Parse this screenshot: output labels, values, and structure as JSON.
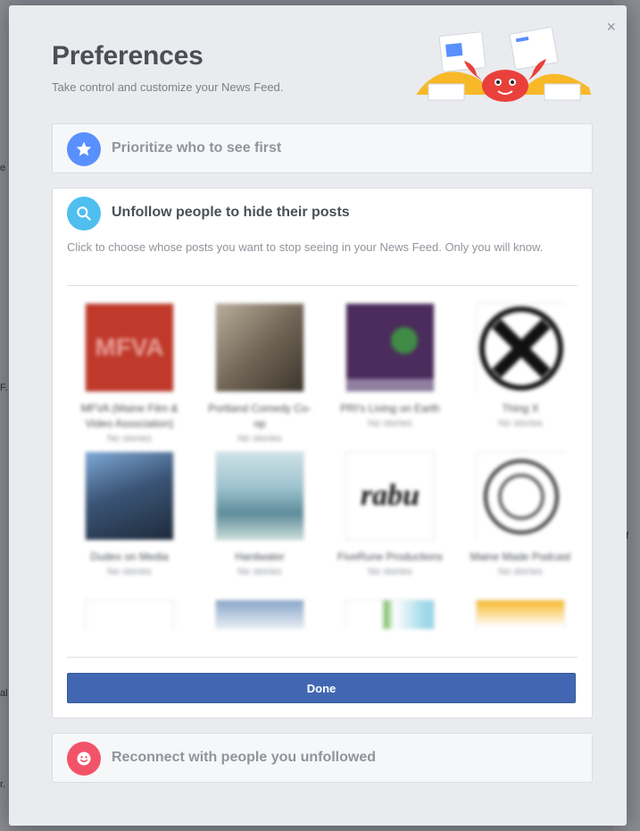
{
  "modal": {
    "title": "Preferences",
    "subtitle": "Take control and customize your News Feed.",
    "close_glyph": "×"
  },
  "sections": {
    "prioritize": {
      "title": "Prioritize who to see first",
      "icon": "star-icon",
      "color": "#5890ff"
    },
    "unfollow": {
      "title": "Unfollow people to hide their posts",
      "icon": "search-icon",
      "color": "#4fbfef",
      "description": "Click to choose whose posts you want to stop seeing in your News Feed. Only you will know.",
      "done_label": "Done"
    },
    "reconnect": {
      "title": "Reconnect with people you unfollowed",
      "icon": "smile-icon",
      "color": "#f35369"
    }
  },
  "pages": [
    {
      "name": "MFVA (Maine Film & Video Association)",
      "meta": "No stories",
      "thumb": "mfva"
    },
    {
      "name": "Portland Comedy Co-op",
      "meta": "No stories",
      "thumb": "sepia"
    },
    {
      "name": "PRI's Living on Earth",
      "meta": "No stories",
      "thumb": "purple"
    },
    {
      "name": "Thing X",
      "meta": "No stories",
      "thumb": "x-logo"
    },
    {
      "name": "Dudes on Media",
      "meta": "No stories",
      "thumb": "photo-blue"
    },
    {
      "name": "Hardwater",
      "meta": "No stories",
      "thumb": "photo-lake"
    },
    {
      "name": "FiveRune Productions",
      "meta": "No stories",
      "thumb": "script"
    },
    {
      "name": "Maine Made Podcast",
      "meta": "No stories",
      "thumb": "circle-logo"
    },
    {
      "name": "",
      "meta": "",
      "thumb": "partial-white"
    },
    {
      "name": "",
      "meta": "",
      "thumb": "partial-blue"
    },
    {
      "name": "",
      "meta": "",
      "thumb": "partial-green"
    },
    {
      "name": "",
      "meta": "",
      "thumb": "partial-yellow"
    }
  ],
  "background_fragments": [
    "e",
    "F.",
    "al",
    "r.",
    "t",
    "k",
    "of"
  ],
  "colors": {
    "primary": "#4267b2",
    "modal_bg": "#e9ebee",
    "title": "#4b4f56"
  }
}
